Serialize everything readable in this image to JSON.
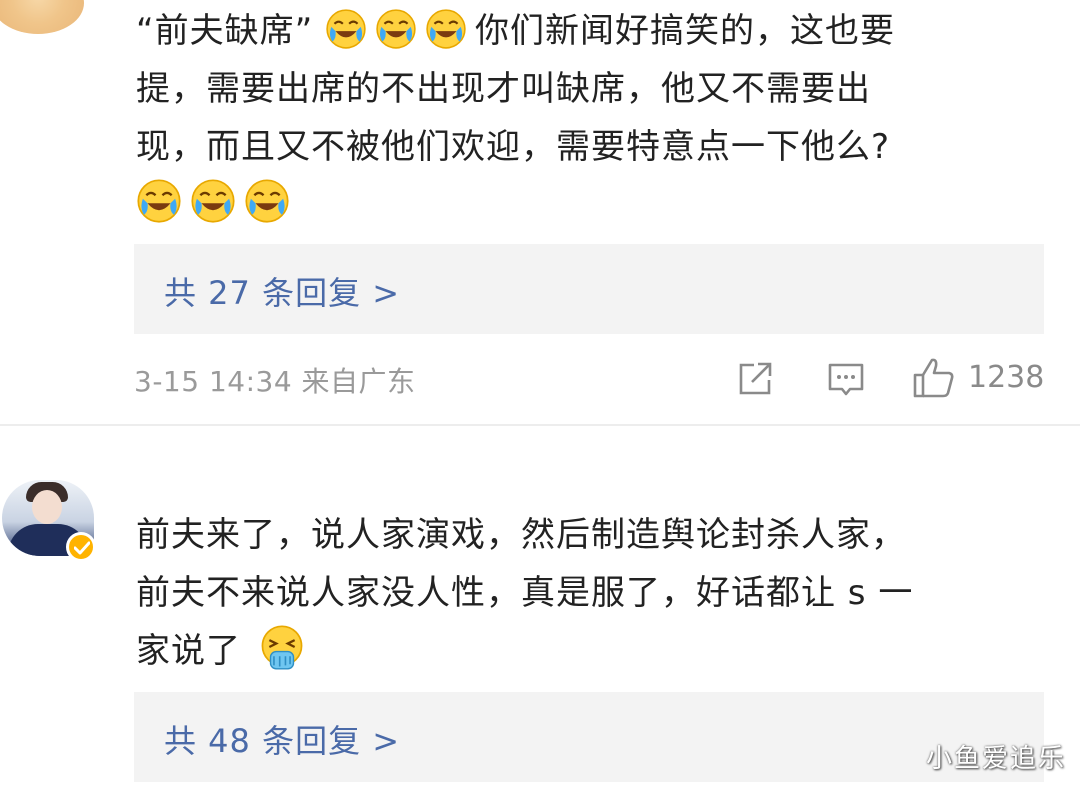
{
  "comments": [
    {
      "quoted": "“前夫缺席”",
      "lines": [
        "你们新闻好搞笑的，这也要",
        "提，需要出席的不出现才叫缺席，他又不需要出",
        "现，而且又不被他们欢迎，需要特意点一下他么?"
      ],
      "inline_emojis": [
        "laugh-cry-icon",
        "laugh-cry-icon",
        "laugh-cry-icon"
      ],
      "trailing_emojis": [
        "laugh-cry-icon",
        "laugh-cry-icon",
        "laugh-cry-icon"
      ],
      "replies_label": "共 27 条回复 >",
      "meta": "3-15 14:34 来自广东",
      "like_count": "1238"
    },
    {
      "lines": [
        "前夫来了，说人家演戏，然后制造舆论封杀人家，",
        "前夫不来说人家没人性，真是服了，好话都让 s 一",
        "家说了"
      ],
      "trailing_emojis": [
        "vomit-face-icon"
      ],
      "replies_label": "共 48 条回复 >"
    }
  ],
  "watermark": "小鱼爱追乐",
  "colors": {
    "link_blue": "#4a6aa8",
    "meta_gray": "#9a9a9a",
    "reply_bg": "#f3f3f3",
    "verify_gold": "#ffb300"
  }
}
